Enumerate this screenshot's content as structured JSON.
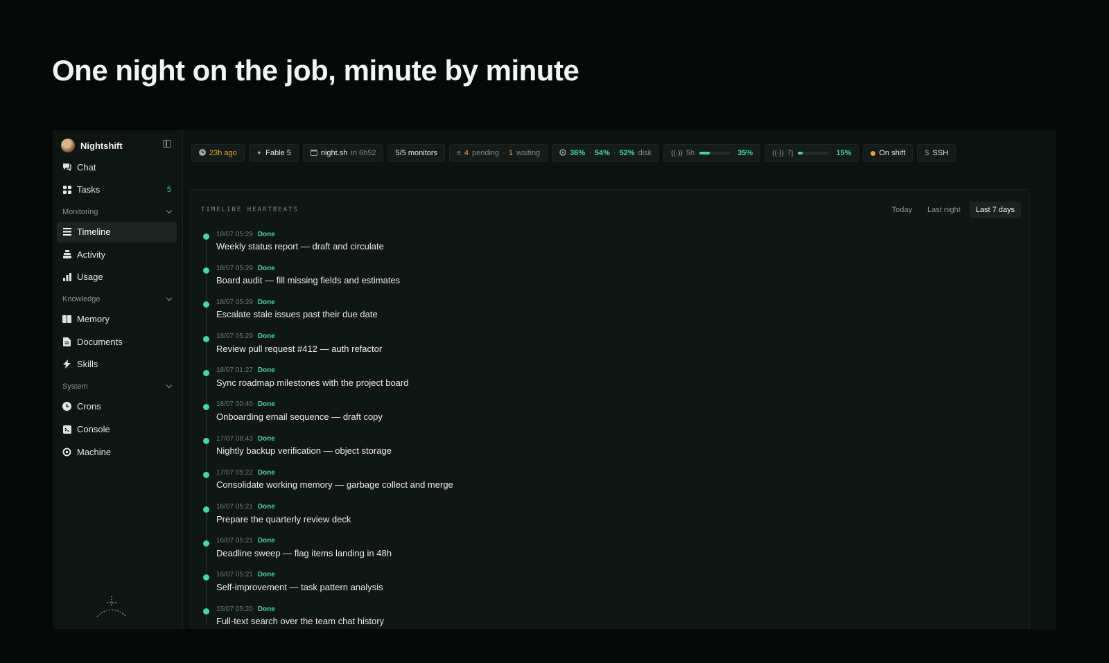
{
  "headline": "One night on the job, minute by minute",
  "sidebar": {
    "brand": "Nightshift",
    "top_items": [
      {
        "label": "Chat",
        "icon": "chat-icon"
      },
      {
        "label": "Tasks",
        "icon": "grid-icon",
        "count": "5"
      }
    ],
    "sections": [
      {
        "title": "Monitoring",
        "items": [
          {
            "label": "Timeline",
            "icon": "list-icon",
            "active": true
          },
          {
            "label": "Activity",
            "icon": "stack-icon"
          },
          {
            "label": "Usage",
            "icon": "bar-chart-icon"
          }
        ]
      },
      {
        "title": "Knowledge",
        "items": [
          {
            "label": "Memory",
            "icon": "book-icon"
          },
          {
            "label": "Documents",
            "icon": "document-icon"
          },
          {
            "label": "Skills",
            "icon": "bolt-icon"
          }
        ]
      },
      {
        "title": "System",
        "items": [
          {
            "label": "Crons",
            "icon": "clock-icon"
          },
          {
            "label": "Console",
            "icon": "terminal-icon"
          },
          {
            "label": "Machine",
            "icon": "cpu-icon"
          }
        ]
      }
    ]
  },
  "topbar": {
    "last_seen": "23h ago",
    "model": "Fable 5",
    "script": "night.sh",
    "script_next": "in 6h52",
    "monitors": "5/5 monitors",
    "pending_count": "4",
    "pending_label": "pending",
    "waiting_count": "1",
    "waiting_label": "waiting",
    "cpu": "36%",
    "mem": "54%",
    "disk": "52%",
    "disk_label": "disk",
    "quota_5h_label": "5h",
    "quota_5h_value": "35%",
    "quota_5h_fraction": 0.35,
    "quota_7j_label": "7j",
    "quota_7j_value": "15%",
    "quota_7j_fraction": 0.15,
    "shift_status": "On shift",
    "ssh": "SSH",
    "ssh_prefix": "$"
  },
  "timeline": {
    "title": "TIMELINE HEARTBEATS",
    "ranges": [
      {
        "label": "Today",
        "active": false
      },
      {
        "label": "Last night",
        "active": false
      },
      {
        "label": "Last 7 days",
        "active": true
      }
    ],
    "entries": [
      {
        "time": "18/07 05:29",
        "status": "Done",
        "text": "Weekly status report — draft and circulate"
      },
      {
        "time": "18/07 05:29",
        "status": "Done",
        "text": "Board audit — fill missing fields and estimates"
      },
      {
        "time": "18/07 05:29",
        "status": "Done",
        "text": "Escalate stale issues past their due date"
      },
      {
        "time": "18/07 05:29",
        "status": "Done",
        "text": "Review pull request #412 — auth refactor"
      },
      {
        "time": "18/07 01:27",
        "status": "Done",
        "text": "Sync roadmap milestones with the project board"
      },
      {
        "time": "18/07 00:40",
        "status": "Done",
        "text": "Onboarding email sequence — draft copy"
      },
      {
        "time": "17/07 08:43",
        "status": "Done",
        "text": "Nightly backup verification — object storage"
      },
      {
        "time": "17/07 05:22",
        "status": "Done",
        "text": "Consolidate working memory — garbage collect and merge"
      },
      {
        "time": "16/07 05:21",
        "status": "Done",
        "text": "Prepare the quarterly review deck"
      },
      {
        "time": "16/07 05:21",
        "status": "Done",
        "text": "Deadline sweep — flag items landing in 48h"
      },
      {
        "time": "16/07 05:21",
        "status": "Done",
        "text": "Self-improvement — task pattern analysis"
      },
      {
        "time": "15/07 05:20",
        "status": "Done",
        "text": "Full-text search over the team chat history"
      }
    ]
  }
}
